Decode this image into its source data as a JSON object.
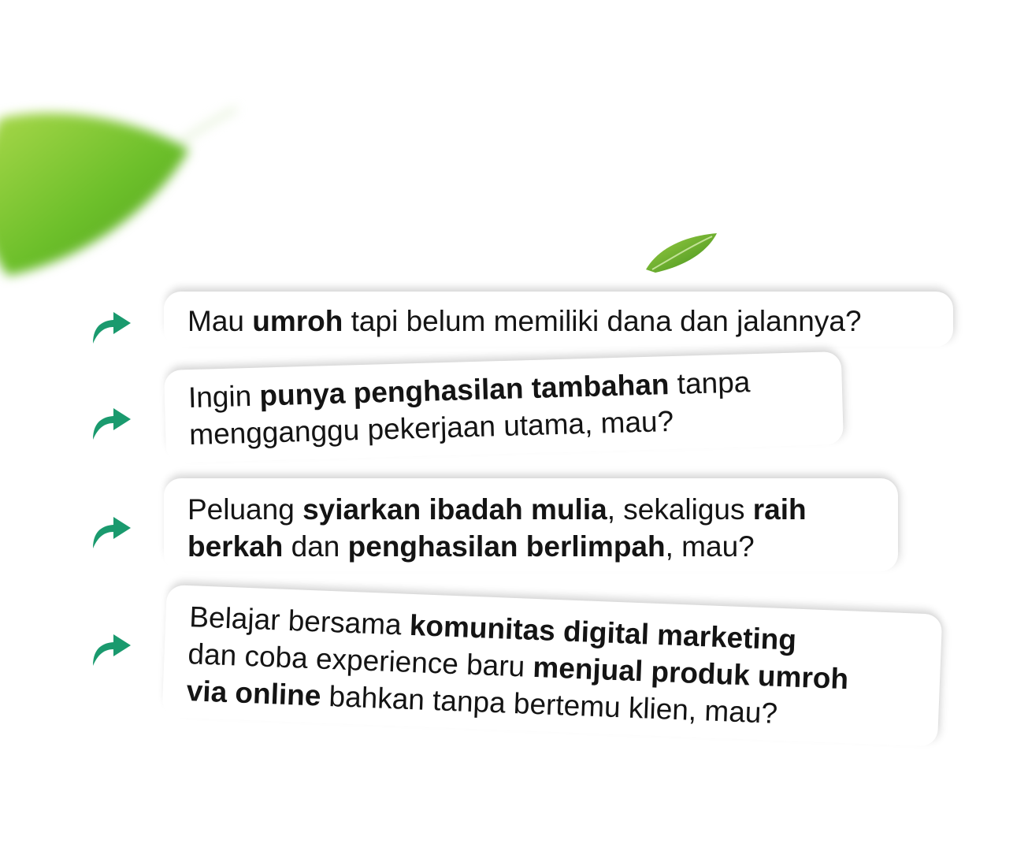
{
  "cards": [
    {
      "lines": [
        [
          {
            "text": "Mau ",
            "bold": false
          },
          {
            "text": "umroh",
            "bold": true
          },
          {
            "text": " tapi belum memiliki dana dan jalannya?",
            "bold": false
          }
        ]
      ]
    },
    {
      "lines": [
        [
          {
            "text": "Ingin ",
            "bold": false
          },
          {
            "text": "punya penghasilan tambahan",
            "bold": true
          },
          {
            "text": " tanpa",
            "bold": false
          }
        ],
        [
          {
            "text": "mengganggu pekerjaan utama, mau?",
            "bold": false
          }
        ]
      ]
    },
    {
      "lines": [
        [
          {
            "text": "Peluang ",
            "bold": false
          },
          {
            "text": "syiarkan ibadah mulia",
            "bold": true
          },
          {
            "text": ", sekaligus ",
            "bold": false
          },
          {
            "text": "raih",
            "bold": true
          }
        ],
        [
          {
            "text": "berkah",
            "bold": true
          },
          {
            "text": " dan ",
            "bold": false
          },
          {
            "text": "penghasilan berlimpah",
            "bold": true
          },
          {
            "text": ", mau?",
            "bold": false
          }
        ]
      ]
    },
    {
      "lines": [
        [
          {
            "text": "Belajar bersama ",
            "bold": false
          },
          {
            "text": "komunitas digital marketing",
            "bold": true
          }
        ],
        [
          {
            "text": "dan coba experience baru ",
            "bold": false
          },
          {
            "text": "menjual produk umroh",
            "bold": true
          }
        ],
        [
          {
            "text": "via online",
            "bold": true
          },
          {
            "text": " bahkan tanpa bertemu klien, mau?",
            "bold": false
          }
        ]
      ]
    }
  ],
  "colors": {
    "arrow": "#1a9a6e",
    "leaf": "#6cbf2a",
    "text": "#141414"
  },
  "icons": {
    "bullet": "curved-share-arrow-icon",
    "decoration": "leaf-icon"
  }
}
